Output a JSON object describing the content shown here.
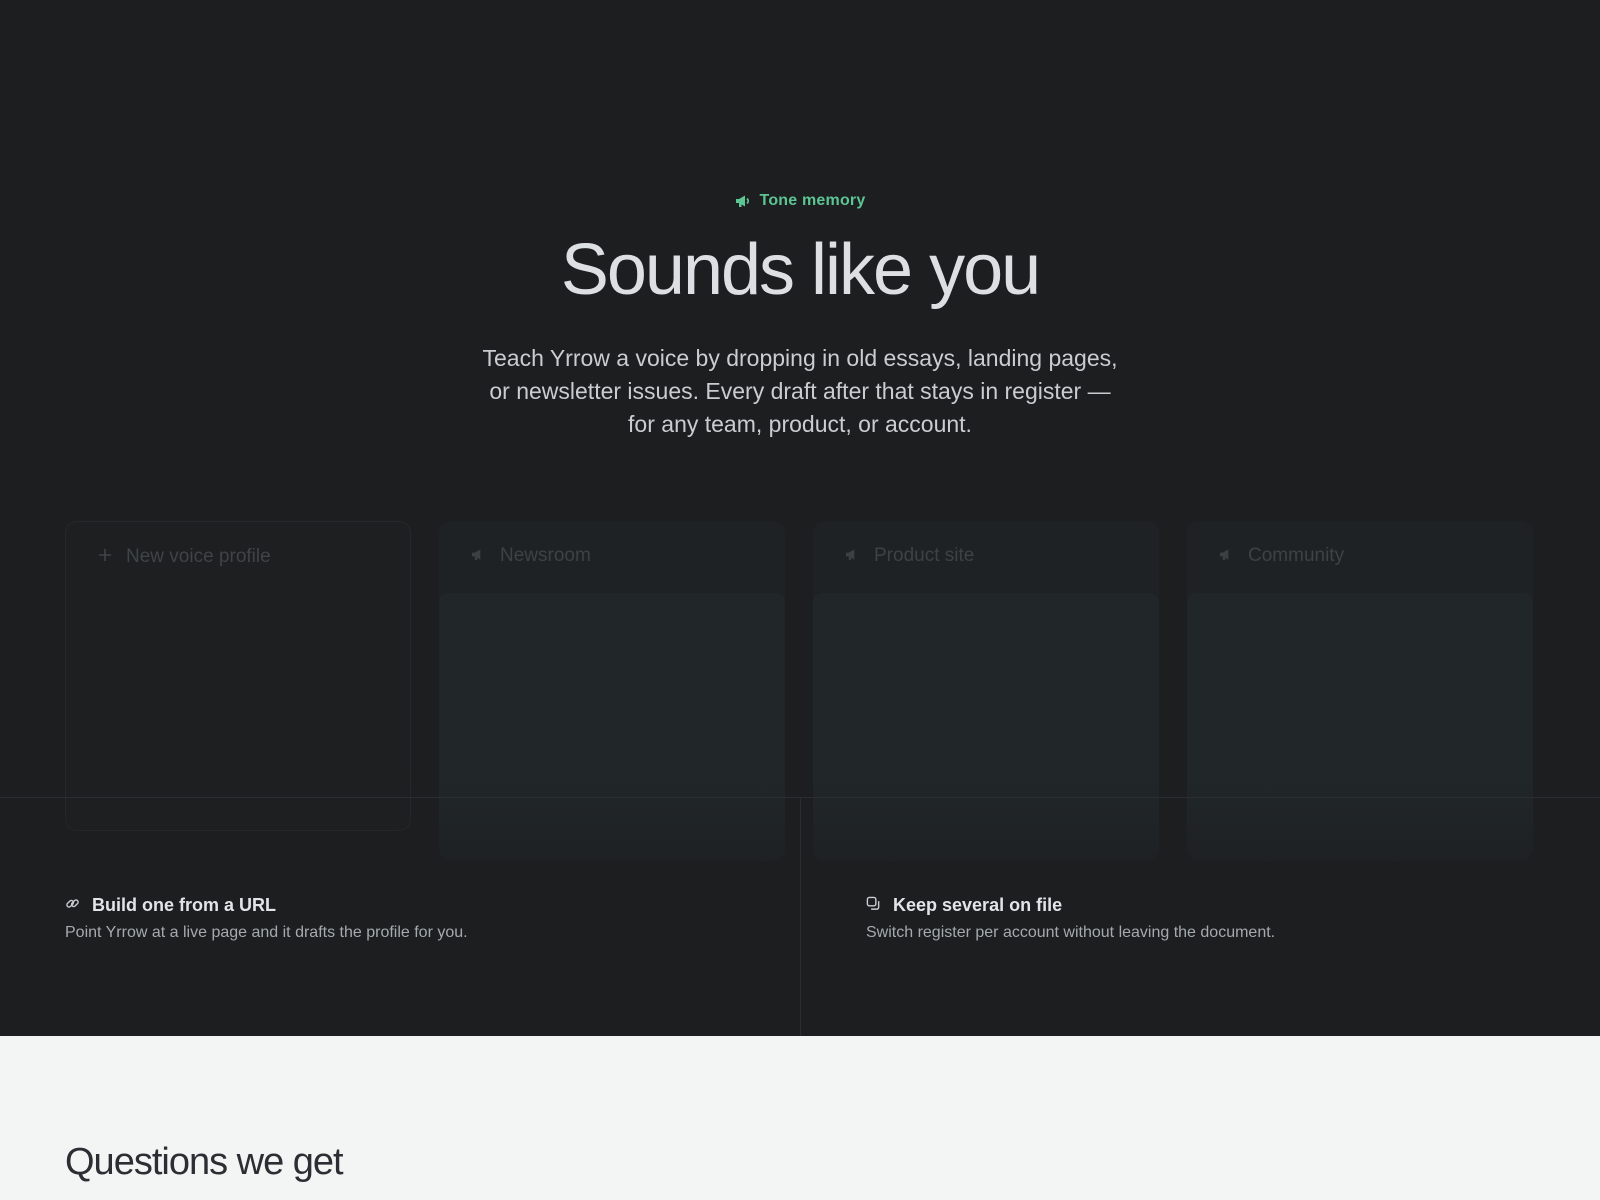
{
  "hero": {
    "eyebrow_icon": "megaphone-icon",
    "eyebrow": "Tone memory",
    "title": "Sounds like you",
    "subtitle": "Teach Yrrow a voice by dropping in old essays, landing pages, or newsletter issues. Every draft after that stays in register — for any team, product, or account."
  },
  "profiles": {
    "new_label": "New voice profile",
    "new_icon": "plus-icon",
    "items": [
      {
        "label": "Newsroom",
        "icon": "megaphone-icon"
      },
      {
        "label": "Product site",
        "icon": "megaphone-icon"
      },
      {
        "label": "Community",
        "icon": "megaphone-icon"
      }
    ]
  },
  "features": [
    {
      "icon": "link-icon",
      "title": "Build one from a URL",
      "description": "Point Yrrow at a live page and it drafts the profile for you."
    },
    {
      "icon": "copy-icon",
      "title": "Keep several on file",
      "description": "Switch register per account without leaving the document."
    }
  ],
  "faq": {
    "title": "Questions we get"
  },
  "colors": {
    "accent": "#5cc593",
    "dark_bg": "#1c1e20",
    "light_bg": "#f3f5f4"
  }
}
